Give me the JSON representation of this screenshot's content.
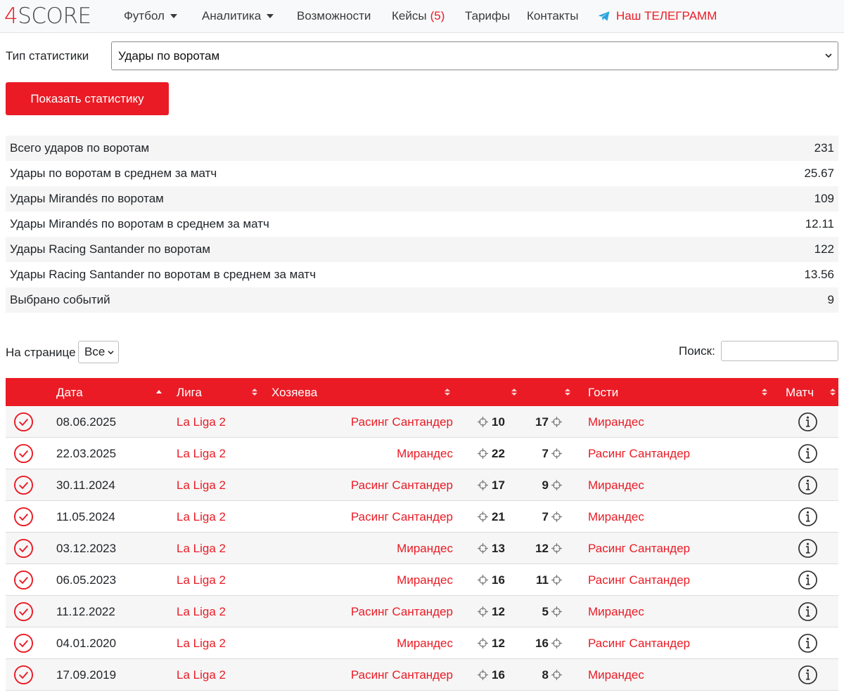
{
  "nav": {
    "logo_four": "4",
    "logo_text": "SCORE",
    "items": [
      {
        "label": "Футбол"
      },
      {
        "label": "Аналитика"
      },
      {
        "label": "Возможности"
      },
      {
        "label": "Кейсы",
        "count": "(5)"
      },
      {
        "label": "Тарифы"
      },
      {
        "label": "Контакты"
      },
      {
        "label": "Наш ТЕЛЕГРАММ"
      }
    ]
  },
  "filter": {
    "label": "Тип статистики",
    "selected": "Удары по воротам",
    "button": "Показать статистику"
  },
  "summary": [
    {
      "label": "Всего ударов по воротам",
      "value": "231"
    },
    {
      "label": "Удары по воротам в среднем за матч",
      "value": "25.67"
    },
    {
      "label": "Удары Mirandés по воротам",
      "value": "109"
    },
    {
      "label": "Удары Mirandés по воротам в среднем за матч",
      "value": "12.11"
    },
    {
      "label": "Удары Racing Santander по воротам",
      "value": "122"
    },
    {
      "label": "Удары Racing Santander по воротам в среднем за матч",
      "value": "13.56"
    },
    {
      "label": "Выбрано событий",
      "value": "9"
    }
  ],
  "controls": {
    "per_page_label": "На странице",
    "per_page_value": "Все",
    "search_label": "Поиск:"
  },
  "table": {
    "headers": {
      "date": "Дата",
      "league": "Лига",
      "home": "Хозяева",
      "away": "Гости",
      "match": "Матч"
    },
    "rows": [
      {
        "date": "08.06.2025",
        "league": "La Liga 2",
        "home": "Расинг Сантандер",
        "home_shots": "10",
        "away_shots": "17",
        "away": "Мирандес"
      },
      {
        "date": "22.03.2025",
        "league": "La Liga 2",
        "home": "Мирандес",
        "home_shots": "22",
        "away_shots": "7",
        "away": "Расинг Сантандер"
      },
      {
        "date": "30.11.2024",
        "league": "La Liga 2",
        "home": "Расинг Сантандер",
        "home_shots": "17",
        "away_shots": "9",
        "away": "Мирандес"
      },
      {
        "date": "11.05.2024",
        "league": "La Liga 2",
        "home": "Расинг Сантандер",
        "home_shots": "21",
        "away_shots": "7",
        "away": "Мирандес"
      },
      {
        "date": "03.12.2023",
        "league": "La Liga 2",
        "home": "Мирандес",
        "home_shots": "13",
        "away_shots": "12",
        "away": "Расинг Сантандер"
      },
      {
        "date": "06.05.2023",
        "league": "La Liga 2",
        "home": "Мирандес",
        "home_shots": "16",
        "away_shots": "11",
        "away": "Расинг Сантандер"
      },
      {
        "date": "11.12.2022",
        "league": "La Liga 2",
        "home": "Расинг Сантандер",
        "home_shots": "12",
        "away_shots": "5",
        "away": "Мирандес"
      },
      {
        "date": "04.01.2020",
        "league": "La Liga 2",
        "home": "Мирандес",
        "home_shots": "12",
        "away_shots": "16",
        "away": "Расинг Сантандер"
      },
      {
        "date": "17.09.2019",
        "league": "La Liga 2",
        "home": "Расинг Сантандер",
        "home_shots": "16",
        "away_shots": "8",
        "away": "Мирандес"
      }
    ]
  },
  "colors": {
    "accent": "#ea1b25",
    "telegram": "#2aa3de"
  },
  "icons": {
    "check": "check-circle-icon",
    "info": "info-circle-icon",
    "target": "crosshair-icon",
    "telegram": "telegram-icon"
  }
}
